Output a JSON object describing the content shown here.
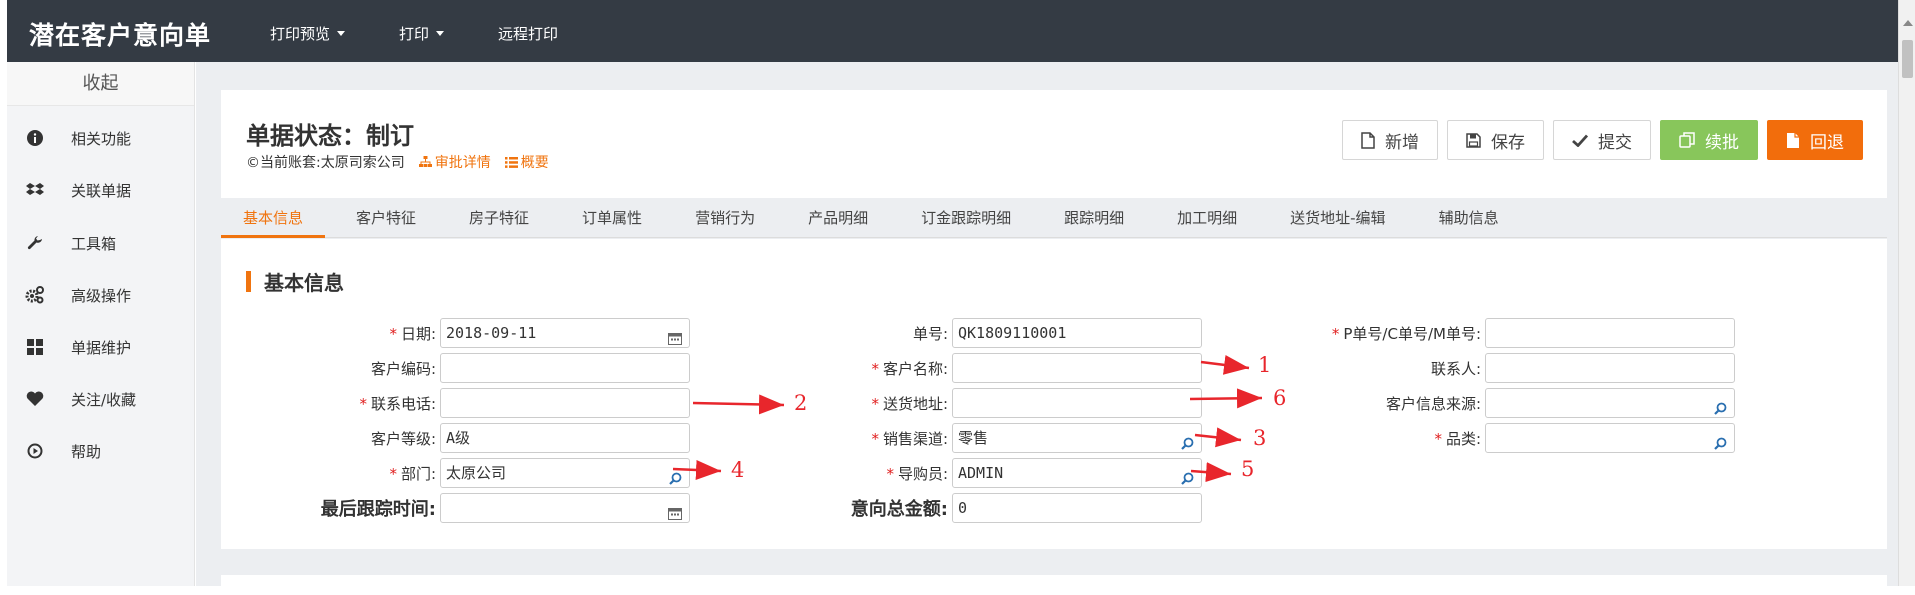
{
  "app_title": "潜在客户意向单",
  "topnav": [
    {
      "label": "打印预览",
      "dropdown": true
    },
    {
      "label": "打印",
      "dropdown": true
    },
    {
      "label": "远程打印",
      "dropdown": false
    }
  ],
  "sidebar": {
    "collapse_label": "收起",
    "items": [
      {
        "label": "相关功能",
        "icon": "info-circle-icon"
      },
      {
        "label": "关联单据",
        "icon": "dropbox-icon"
      },
      {
        "label": "工具箱",
        "icon": "wrench-icon"
      },
      {
        "label": "高级操作",
        "icon": "gears-icon"
      },
      {
        "label": "单据维护",
        "icon": "grid-icon"
      },
      {
        "label": "关注/收藏",
        "icon": "heart-icon"
      },
      {
        "label": "帮助",
        "icon": "play-circle-icon"
      }
    ]
  },
  "header": {
    "status": "单据状态：制订",
    "account": "©当前账套:太原司索公司",
    "approval_link": "审批详情",
    "summary_link": "概要"
  },
  "buttons": {
    "new": "新增",
    "save": "保存",
    "submit": "提交",
    "continue": "续批",
    "return": "回退"
  },
  "tabs": [
    "基本信息",
    "客户特征",
    "房子特征",
    "订单属性",
    "营销行为",
    "产品明细",
    "订金跟踪明细",
    "跟踪明细",
    "加工明细",
    "送货地址-编辑",
    "辅助信息"
  ],
  "section_title": "基本信息",
  "form": {
    "col1": [
      {
        "label": "日期:",
        "required": true,
        "value": "2018-09-11",
        "icon": "calendar-icon"
      },
      {
        "label": "客户编码:",
        "required": false,
        "value": ""
      },
      {
        "label": "联系电话:",
        "required": true,
        "value": ""
      },
      {
        "label": "客户等级:",
        "required": false,
        "value": "A级"
      },
      {
        "label": "部门:",
        "required": true,
        "value": "太原公司",
        "icon": "search-icon"
      },
      {
        "label": "最后跟踪时间:",
        "required": false,
        "value": "",
        "icon": "calendar-icon",
        "big": true
      }
    ],
    "col2": [
      {
        "label": "单号:",
        "required": false,
        "value": "QK1809110001"
      },
      {
        "label": "客户名称:",
        "required": true,
        "value": ""
      },
      {
        "label": "送货地址:",
        "required": true,
        "value": ""
      },
      {
        "label": "销售渠道:",
        "required": true,
        "value": "零售",
        "icon": "search-icon"
      },
      {
        "label": "导购员:",
        "required": true,
        "value": "ADMIN",
        "icon": "search-icon"
      },
      {
        "label": "意向总金额:",
        "required": false,
        "value": "0",
        "big": true
      }
    ],
    "col3": [
      {
        "label": "P单号/C单号/M单号:",
        "required": true,
        "value": ""
      },
      {
        "label": "联系人:",
        "required": false,
        "value": ""
      },
      {
        "label": "客户信息来源:",
        "required": false,
        "value": "",
        "icon": "search-icon"
      },
      {
        "label": "品类:",
        "required": true,
        "value": "",
        "icon": "search-icon"
      }
    ]
  },
  "annotations": [
    "1",
    "2",
    "3",
    "4",
    "5",
    "6"
  ],
  "colors": {
    "topbar": "#343b44",
    "accent": "#f0740f",
    "required": "#e02020",
    "green": "#88c65b",
    "orange": "#f26d0c",
    "arrow": "#e8262c"
  }
}
